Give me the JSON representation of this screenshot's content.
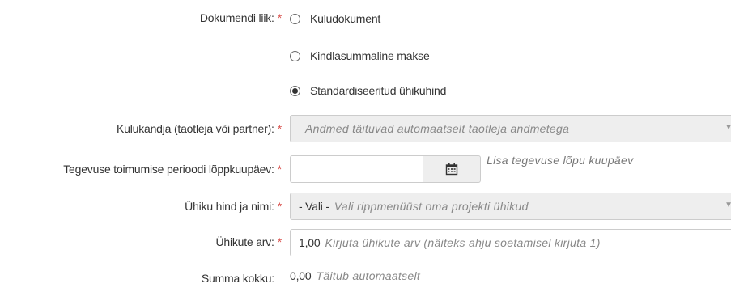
{
  "required_marker": "*",
  "document_type": {
    "label": "Dokumendi liik:",
    "options": [
      {
        "label": "Kuludokument",
        "checked": false
      },
      {
        "label": "Kindlasummaline makse",
        "checked": false
      },
      {
        "label": "Standardiseeritud ühikuhind",
        "checked": true
      }
    ]
  },
  "cost_bearer": {
    "label": "Kulukandja (taotleja või partner):",
    "placeholder": "Andmed täituvad automaatselt taotleja andmetega"
  },
  "end_date": {
    "label": "Tegevuse toimumise perioodi lõppkuupäev:",
    "value": "",
    "hint": "Lisa tegevuse lõpu kuupäev"
  },
  "unit_price": {
    "label": "Ühiku hind ja nimi:",
    "value": "- Vali -",
    "hint": "Vali rippmenüüst oma projekti ühikud"
  },
  "unit_count": {
    "label": "Ühikute arv:",
    "value": "1,00",
    "hint": "Kirjuta ühikute arv (näiteks ahju soetamisel kirjuta 1)"
  },
  "total": {
    "label": "Summa kokku:",
    "value": "0,00",
    "hint": "Täitub automaatselt"
  }
}
